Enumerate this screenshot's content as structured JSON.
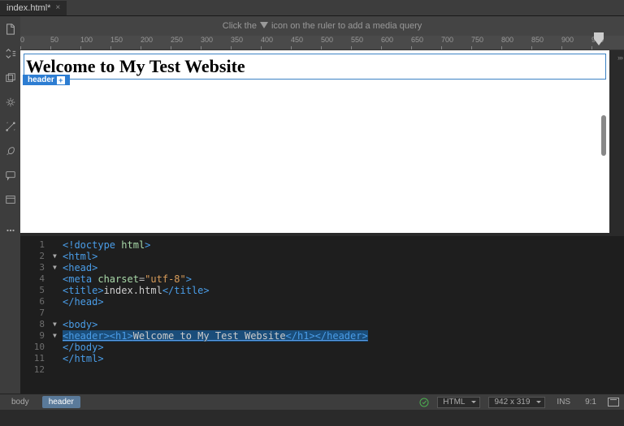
{
  "tabs": {
    "active": "index.html*"
  },
  "hint": {
    "pre": "Click the",
    "post": "icon on the ruler to add a media query"
  },
  "ruler": {
    "ticks": [
      "0",
      "50",
      "100",
      "150",
      "200",
      "250",
      "300",
      "350",
      "400",
      "450",
      "500",
      "550",
      "600",
      "650",
      "700",
      "750",
      "800",
      "850",
      "900",
      "950"
    ]
  },
  "rendered": {
    "h1": "Welcome to My Test Website",
    "badge": "header"
  },
  "code": {
    "lines": [
      {
        "n": 1,
        "fold": "",
        "html": "<span class='tag'>&lt;!doctype</span> <span class='attr'>html</span><span class='tag'>&gt;</span>"
      },
      {
        "n": 2,
        "fold": "▼",
        "html": "<span class='tag'>&lt;html&gt;</span>"
      },
      {
        "n": 3,
        "fold": "▼",
        "html": "<span class='tag'>&lt;head&gt;</span>"
      },
      {
        "n": 4,
        "fold": "",
        "html": "<span class='tag'>&lt;meta</span> <span class='attr'>charset</span>=<span class='val'>\"utf-8\"</span><span class='tag'>&gt;</span>"
      },
      {
        "n": 5,
        "fold": "",
        "html": "<span class='tag'>&lt;title&gt;</span><span class='txt'>index.html</span><span class='tag'>&lt;/title&gt;</span>"
      },
      {
        "n": 6,
        "fold": "",
        "html": "<span class='tag'>&lt;/head&gt;</span>"
      },
      {
        "n": 7,
        "fold": "",
        "html": ""
      },
      {
        "n": 8,
        "fold": "▼",
        "html": "<span class='tag'>&lt;body&gt;</span>"
      },
      {
        "n": 9,
        "fold": "▼",
        "sel": true,
        "html": "<span class='tag'>&lt;header&gt;&lt;h1&gt;</span><span class='txt'>Welcome to My Test Website</span><span class='tag'>&lt;/h1&gt;&lt;/header&gt;</span>"
      },
      {
        "n": 10,
        "fold": "",
        "html": "<span class='tag'>&lt;/body&gt;</span>"
      },
      {
        "n": 11,
        "fold": "",
        "html": "<span class='tag'>&lt;/html&gt;</span>"
      },
      {
        "n": 12,
        "fold": "",
        "html": ""
      }
    ]
  },
  "status": {
    "breadcrumb": [
      "body",
      "header"
    ],
    "lang": "HTML",
    "dims": "942 x 319",
    "ins": "INS",
    "pos": "9:1"
  }
}
